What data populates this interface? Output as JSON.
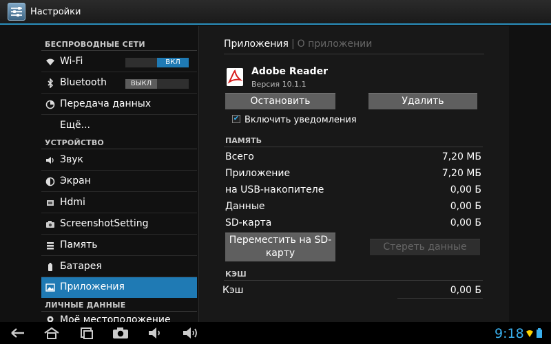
{
  "titlebar": {
    "title": "Настройки",
    "icon": "settings-sliders-icon"
  },
  "sidebar": {
    "categories": {
      "wireless": "БЕСПРОВОДНЫЕ СЕТИ",
      "device": "УСТРОЙСТВО",
      "personal": "ЛИЧНЫЕ ДАННЫЕ"
    },
    "items": [
      {
        "label": "Wi-Fi",
        "icon": "wifi-icon",
        "toggle": "ВКЛ"
      },
      {
        "label": "Bluetooth",
        "icon": "bluetooth-icon",
        "toggle": "ВЫКЛ"
      },
      {
        "label": "Передача данных",
        "icon": "data-usage-icon"
      },
      {
        "label": "Ещё..."
      },
      {
        "label": "Звук",
        "icon": "speaker-icon"
      },
      {
        "label": "Экран",
        "icon": "brightness-icon"
      },
      {
        "label": "Hdmi",
        "icon": "hdmi-icon"
      },
      {
        "label": "ScreenshotSetting",
        "icon": "camera-icon"
      },
      {
        "label": "Память",
        "icon": "storage-icon"
      },
      {
        "label": "Батарея",
        "icon": "battery-icon"
      },
      {
        "label": "Приложения",
        "icon": "apps-icon",
        "selected": true
      },
      {
        "label": "Моё местоположение",
        "icon": "location-icon"
      }
    ]
  },
  "detail": {
    "tabs": {
      "active": "Приложения",
      "inactive": "О приложении"
    },
    "app": {
      "name": "Adobe Reader",
      "version": "Версия 10.1.1",
      "icon": "adobe-reader-icon"
    },
    "buttons": {
      "stop": "Остановить",
      "delete": "Удалить"
    },
    "notifications_label": "Включить уведомления",
    "notifications_checked": true,
    "memory_header": "ПАМЯТЬ",
    "memory_rows": [
      {
        "label": "Всего",
        "value": "7,20 МБ"
      },
      {
        "label": "Приложение",
        "value": "7,20 МБ"
      },
      {
        "label": "на USB-накопителе",
        "value": "0,00 Б"
      },
      {
        "label": "Данные",
        "value": "0,00 Б"
      },
      {
        "label": "SD-карта",
        "value": "0,00 Б"
      }
    ],
    "move_button": "Переместить на SD-карту",
    "clear_data_button": "Стереть данные",
    "cache_header": "КЭШ",
    "cache_row": {
      "label": "Кэш",
      "value": "0,00 Б"
    }
  },
  "navbar": {
    "clock": "9:18"
  },
  "colors": {
    "accent": "#1f7ab4",
    "clock": "#3ab0ee"
  }
}
